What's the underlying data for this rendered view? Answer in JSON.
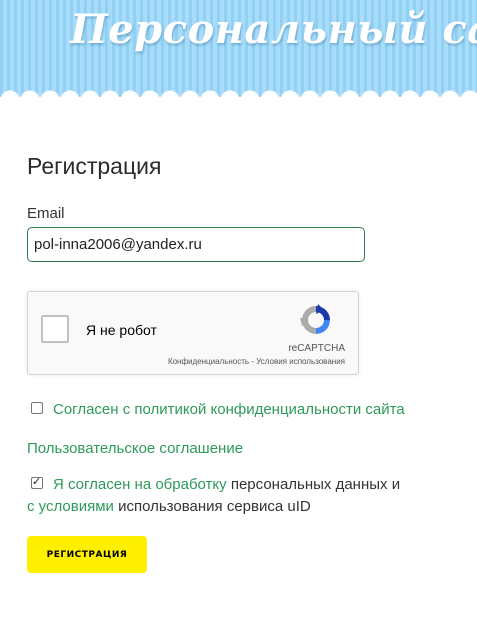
{
  "header": {
    "title": "Персональный сайт"
  },
  "form": {
    "title": "Регистрация",
    "email_label": "Email",
    "email_value": "pol-inna2006@yandex.ru"
  },
  "recaptcha": {
    "label": "Я не робот",
    "brand": "reCAPTCHA",
    "privacy_link": "Конфиденциальность",
    "separator": " - ",
    "terms_link": "Условия использования"
  },
  "privacy_checkbox": {
    "checked": false,
    "label": "Согласен с политикой конфиденциальности сайта"
  },
  "user_agreement_link": "Пользовательское соглашение",
  "consent": {
    "checked": true,
    "link_text": "Я согласен на обработку",
    "text_1": " персональных данных и",
    "link_text_2": "с условиями",
    "text_2": " использования сервиса uID"
  },
  "submit_button": {
    "label": "РЕГИСТРАЦИЯ"
  },
  "colors": {
    "accent_green": "#2e9a5a",
    "button_yellow": "#ffef00",
    "header_blue": "#a8dcf8",
    "input_border": "#2f7b4f"
  }
}
